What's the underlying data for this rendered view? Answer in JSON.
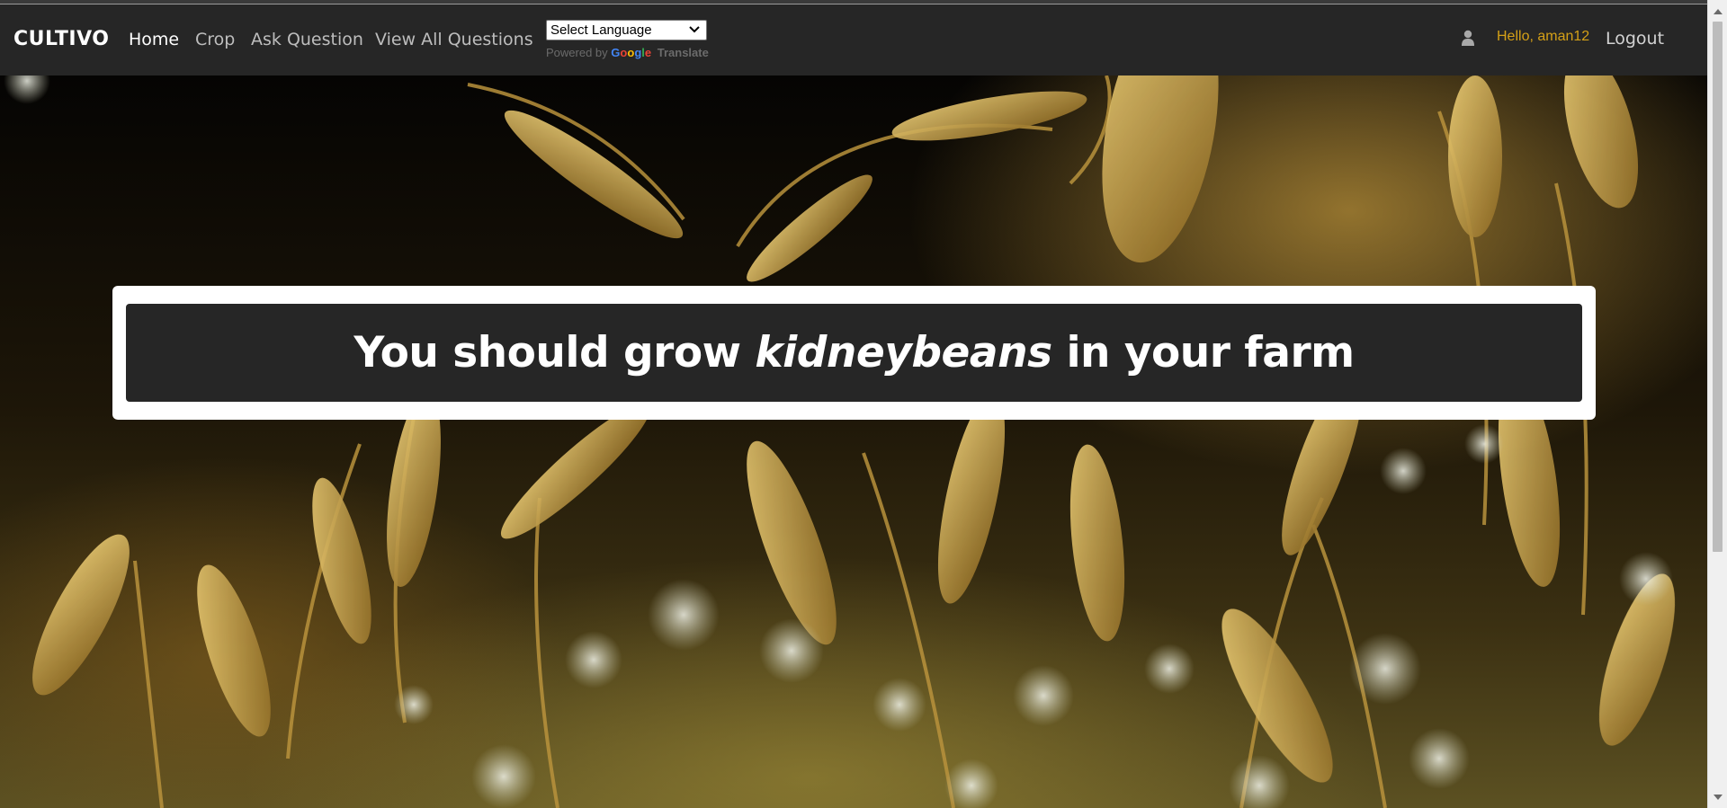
{
  "navbar": {
    "brand": "CULTIVO",
    "links": [
      {
        "label": "Home",
        "active": true
      },
      {
        "label": "Crop",
        "active": false
      },
      {
        "label": "Ask Question",
        "active": false
      },
      {
        "label": "View All Questions",
        "active": false
      }
    ],
    "translate": {
      "select_value": "Select Language",
      "powered_by": "Powered by",
      "google": "Google",
      "translate": "Translate"
    },
    "user_icon": "user-icon",
    "greeting": "Hello, aman12",
    "logout_label": "Logout"
  },
  "result": {
    "prefix": "You should grow",
    "crop": "kidneybeans",
    "suffix": "in your farm"
  },
  "colors": {
    "navbar_bg": "#262626",
    "greeting": "#d4a017",
    "card_inner": "#262626"
  }
}
